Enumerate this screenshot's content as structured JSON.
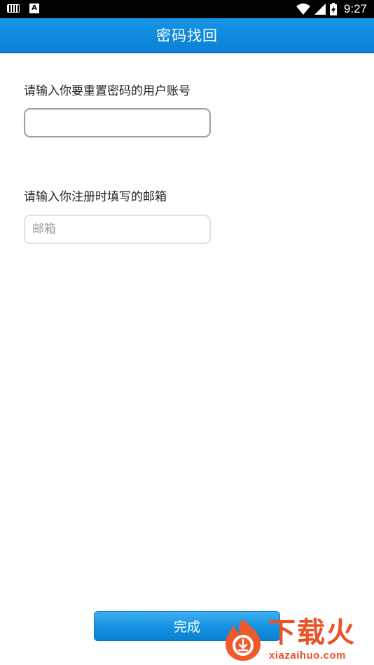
{
  "status_bar": {
    "time": "9:27",
    "icons": [
      "keyboard-icon",
      "a-notification-icon",
      "wifi-icon",
      "signal-icon",
      "battery-charging-icon"
    ]
  },
  "header": {
    "title": "密码找回"
  },
  "form": {
    "username_label": "请输入你要重置密码的用户账号",
    "username_value": "",
    "email_label": "请输入你注册时填写的邮箱",
    "email_placeholder": "邮箱"
  },
  "footer": {
    "done_label": "完成"
  },
  "watermark": {
    "brand": "下载火",
    "domain": "xiazaihuo.com"
  },
  "colors": {
    "title_bar": "#0b82d6",
    "button": "#1391e2",
    "watermark": "#e8532a"
  }
}
